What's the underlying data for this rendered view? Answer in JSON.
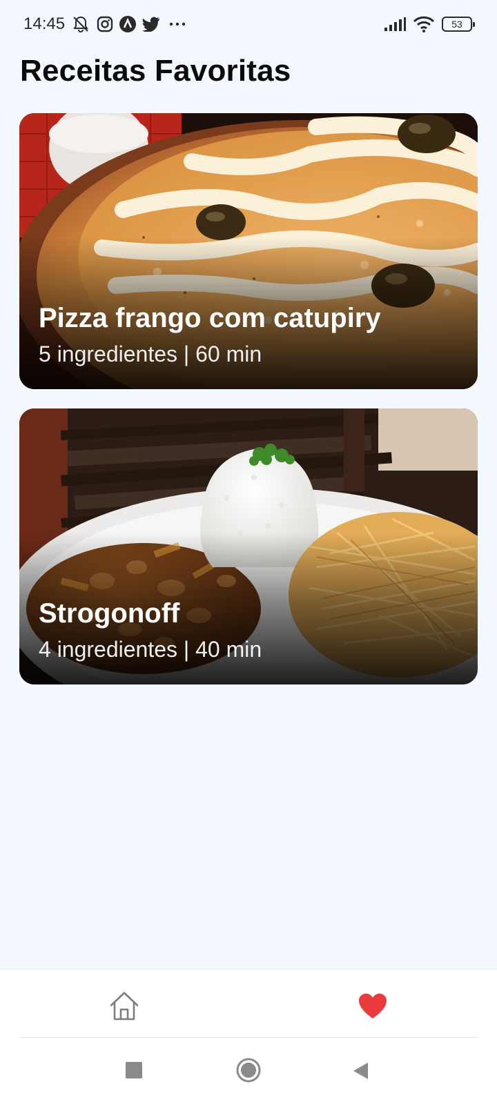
{
  "status_bar": {
    "time": "14:45",
    "left_icons": [
      "mute-bell-icon",
      "instagram-icon",
      "nav-app-icon",
      "twitter-icon",
      "more-dots-icon"
    ],
    "right_icons": [
      "signal-icon",
      "wifi-icon"
    ],
    "battery": "53"
  },
  "header": {
    "title": "Receitas Favoritas"
  },
  "recipes": [
    {
      "name": "Pizza frango com catupiry",
      "meta": "5 ingredientes | 60 min",
      "image": "pizza-photo"
    },
    {
      "name": "Strogonoff",
      "meta": "4 ingredientes | 40 min",
      "image": "strogonoff-photo"
    }
  ],
  "bottom_nav": {
    "items": [
      {
        "name": "home",
        "icon": "home-icon",
        "active": false
      },
      {
        "name": "favorites",
        "icon": "heart-icon",
        "active": true
      }
    ],
    "active_color": "#ec3b3f",
    "inactive_color": "#7d7d7d"
  },
  "system_nav": {
    "buttons": [
      "recents-button",
      "home-button",
      "back-button"
    ]
  }
}
